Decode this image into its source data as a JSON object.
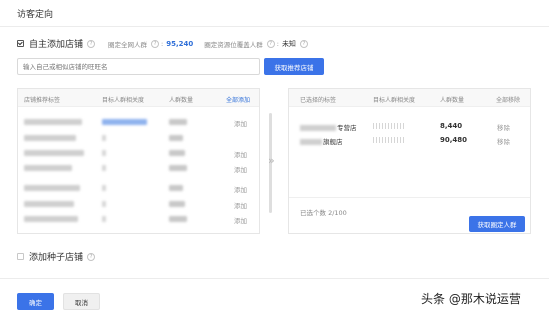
{
  "header": {
    "title": "访客定向"
  },
  "self_add": {
    "label": "自主添加店铺",
    "checked": true,
    "help_glyph": "?",
    "estimate_label": "圈定全网人群",
    "estimate_value": "95,240",
    "coverage_label": "圈定资源位覆盖人群",
    "coverage_value": "未知"
  },
  "search": {
    "placeholder": "输入自己或相似店铺的旺旺名",
    "button_label": "获取推荐店铺"
  },
  "left_table": {
    "columns": [
      "店铺推荐标签",
      "目标人群相关度",
      "人群数量",
      "全部添加"
    ],
    "add_label": "添加",
    "row_add": [
      true,
      false,
      true,
      true,
      false,
      true,
      false,
      true
    ]
  },
  "right_table": {
    "columns": [
      "已选择的标签",
      "目标人群相关度",
      "人群数量",
      "全部移除"
    ],
    "rows": [
      {
        "name_suffix": "专营店",
        "count": "8,440",
        "remove": "移除"
      },
      {
        "name_suffix": "旗舰店",
        "count": "90,480",
        "remove": "移除"
      }
    ],
    "selected_count": "已选个数 2/100",
    "get_button": "获取圈定人群"
  },
  "seed": {
    "label": "添加种子店铺"
  },
  "footer": {
    "confirm": "确定",
    "cancel": "取消"
  },
  "watermark": "头条 @那木说运营",
  "colors": {
    "primary": "#3b73e8",
    "link": "#2f6fd8"
  },
  "icons": [
    "arrow-right-icon",
    "help-icon",
    "checkbox-icon"
  ]
}
